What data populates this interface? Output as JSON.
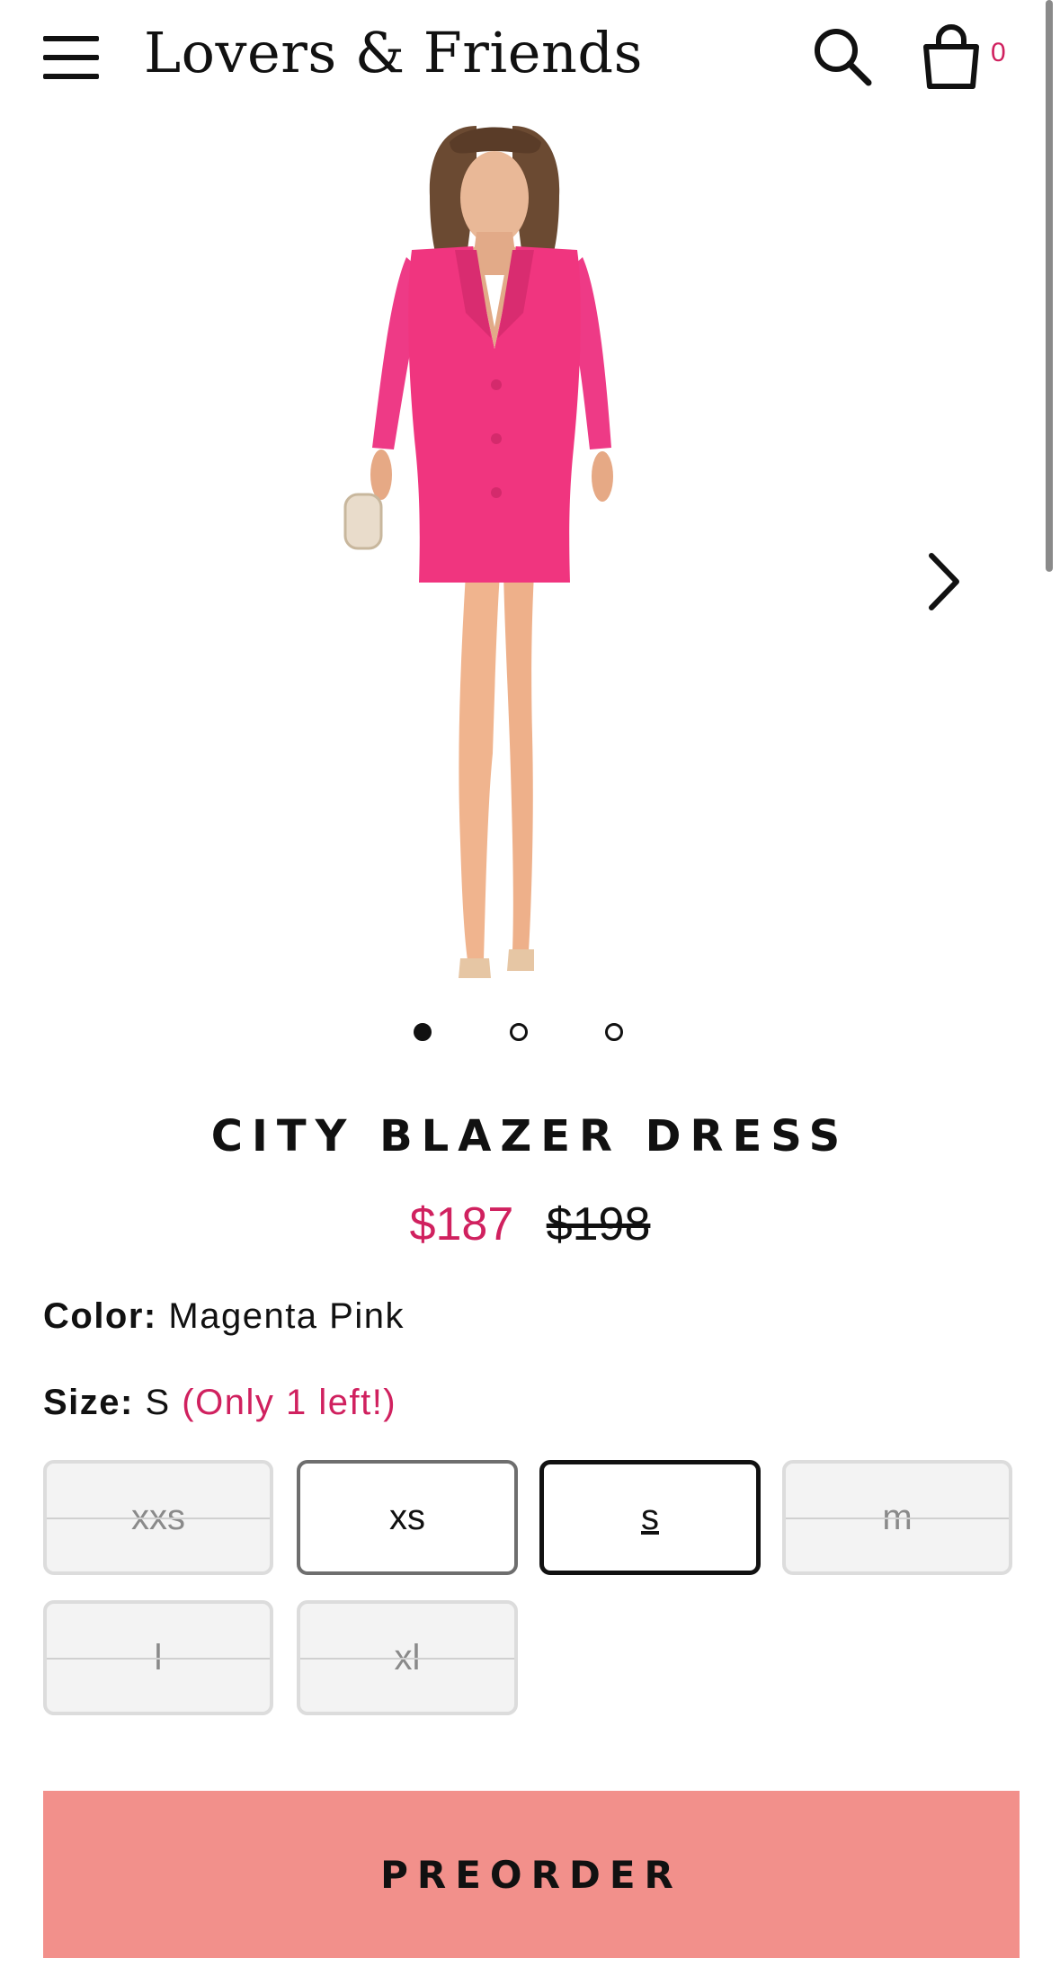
{
  "header": {
    "brand": "Lovers & Friends",
    "cart_count": "0"
  },
  "product": {
    "image_alt": "Model wearing pink blazer dress",
    "title": "CITY BLAZER DRESS",
    "price_sale": "$187",
    "price_original": "$198",
    "color_label": "Color:",
    "color_value": "Magenta Pink",
    "size_label": "Size:",
    "size_value": "S",
    "size_note": "(Only 1 left!)",
    "carousel_active_index": 1,
    "carousel_count": 3
  },
  "sizes": [
    {
      "label": "xxs",
      "state": "unavailable"
    },
    {
      "label": "xs",
      "state": "available"
    },
    {
      "label": "s",
      "state": "selected"
    },
    {
      "label": "m",
      "state": "unavailable"
    },
    {
      "label": "l",
      "state": "unavailable"
    },
    {
      "label": "xl",
      "state": "unavailable"
    }
  ],
  "cta": {
    "label": "PREORDER"
  },
  "colors": {
    "accent": "#d0215f",
    "dress_pink": "#f0357f",
    "preorder_bg": "#f2908b"
  }
}
